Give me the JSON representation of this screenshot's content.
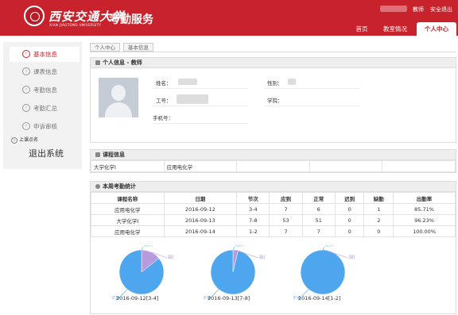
{
  "header": {
    "logo_cn": "西安交通大学",
    "logo_en": "XIAN JIAOTONG UNIVERSITY",
    "app_name": "考勤服务",
    "user_role": "教师",
    "logout": "安全退出",
    "nav": [
      "首页",
      "教室情况",
      "个人中心"
    ],
    "active_nav": "个人中心"
  },
  "sidebar": {
    "items": [
      "基本信息",
      "课表信息",
      "考勤信息",
      "考勤汇总",
      "申诉审核"
    ],
    "active": "基本信息",
    "sub_label": "上课点名",
    "exit_label": "退出系统"
  },
  "breadcrumb": [
    "个人中心",
    "基本信息"
  ],
  "personal": {
    "title": "个人信息 - 教师",
    "name_label": "姓名：",
    "gender_label": "性别：",
    "id_label": "工号：",
    "college_label": "学院：",
    "phone_label": "手机号："
  },
  "course": {
    "title": "课程信息",
    "courses": [
      "大学化学I",
      "应用电化学"
    ]
  },
  "attendance": {
    "title": "本周考勤统计",
    "headers": [
      "课程名称",
      "日期",
      "节次",
      "应到",
      "正常",
      "迟到",
      "缺勤",
      "出勤率"
    ],
    "rows": [
      [
        "应用电化学",
        "2016-09-12",
        "3-4",
        "7",
        "6",
        "0",
        "1",
        "85.71%"
      ],
      [
        "大学化学I",
        "2016-09-13",
        "7-8",
        "53",
        "51",
        "0",
        "2",
        "96.23%"
      ],
      [
        "应用电化学",
        "2016-09-14",
        "1-2",
        "7",
        "7",
        "0",
        "0",
        "100.00%"
      ]
    ],
    "pies": [
      {
        "caption": "2016-09-12[3-4]",
        "normal": 6,
        "late": 0,
        "absent": 1,
        "normal_label": "正常",
        "late_label": "迟到",
        "absent_label": "缺勤"
      },
      {
        "caption": "2016-09-13[7-8]",
        "normal": 51,
        "late": 0,
        "absent": 2,
        "normal_label": "正常",
        "late_label": "迟到",
        "absent_label": "缺勤"
      },
      {
        "caption": "2016-09-14[1-2]",
        "normal": 7,
        "late": 0,
        "absent": 0,
        "normal_label": "正常",
        "late_label": "迟到",
        "absent_label": "缺勤"
      }
    ]
  },
  "colors": {
    "brand_red": "#c8232c",
    "pie_normal": "#4da6ee",
    "pie_absent": "#b79bdc",
    "pie_late": "#4cc3e6"
  }
}
